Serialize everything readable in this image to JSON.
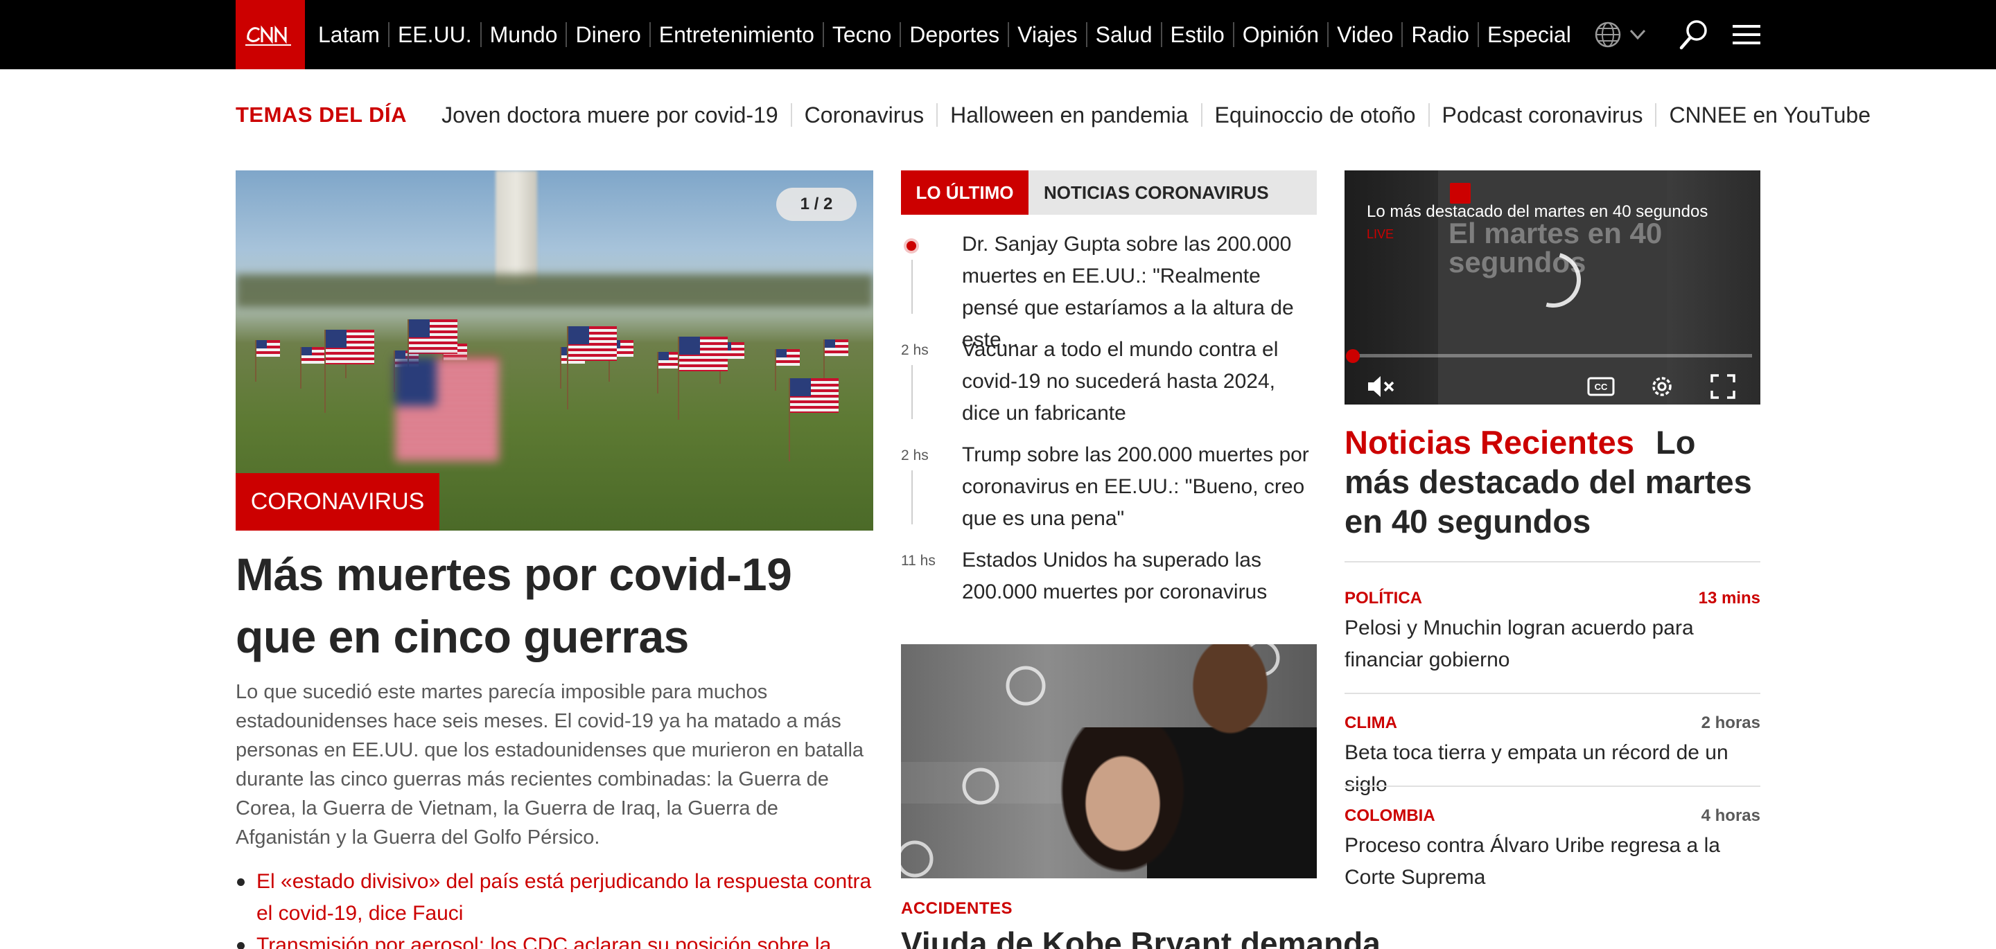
{
  "brand": {
    "logo_text": "CNN",
    "color": "#cc0000"
  },
  "nav": {
    "items": [
      "Latam",
      "EE.UU.",
      "Mundo",
      "Dinero",
      "Entretenimiento",
      "Tecno",
      "Deportes",
      "Viajes",
      "Salud",
      "Estilo",
      "Opinión",
      "Video",
      "Radio",
      "Especial"
    ],
    "icons": [
      "globe-icon",
      "chevron-down-icon",
      "search-icon",
      "menu-icon"
    ]
  },
  "trending": {
    "title": "TEMAS DEL DÍA",
    "items": [
      "Joven doctora muere por covid-19",
      "Coronavirus",
      "Halloween en pandemia",
      "Equinoccio de otoño",
      "Podcast coronavirus",
      "CNNEE en YouTube"
    ]
  },
  "hero": {
    "pager": "1 / 2",
    "label": "CORONAVIRUS",
    "title": "Más muertes por covid-19 que en cinco guerras",
    "summary": "Lo que sucedió este martes parecía imposible para muchos estadounidenses hace seis meses. El covid-19 ya ha matado a más personas en EE.UU. que los estadounidenses que murieron en batalla durante las cinco guerras más recientes combinadas: la Guerra de Corea, la Guerra de Vietnam, la Guerra de Iraq, la Guerra de Afganistán y la Guerra del Golfo Pérsico.",
    "links": [
      "El «estado divisivo» del país está perjudicando la respuesta contra el covid-19, dice Fauci",
      "Transmisión por aerosol: los CDC aclaran su posición sobre la"
    ]
  },
  "latest": {
    "tabs": [
      "LO ÚLTIMO",
      "NOTICIAS CORONAVIRUS"
    ],
    "items": [
      {
        "time": "",
        "live": true,
        "text": "Dr. Sanjay Gupta sobre las 200.000 muertes en EE.UU.: \"Realmente pensé que estaríamos a la altura de este..."
      },
      {
        "time": "2 hs",
        "live": false,
        "text": "Vacunar a todo el mundo contra el covid-19 no sucederá hasta 2024, dice un fabricante"
      },
      {
        "time": "2 hs",
        "live": false,
        "text": "Trump sobre las 200.000 muertes por coronavirus en EE.UU.: \"Bueno, creo que es una pena\""
      },
      {
        "time": "11 hs",
        "live": false,
        "text": "Estados Unidos ha superado las 200.000 muertes por coronavirus"
      }
    ]
  },
  "kobe": {
    "label": "ACCIDENTES",
    "title": "Viuda de Kobe Bryant demanda"
  },
  "video": {
    "title": "Lo más destacado del martes en 40 segundos",
    "live": "LIVE",
    "ghost_text": "El martes en 40 segundos",
    "controls": [
      "mute-icon",
      "cc-icon",
      "settings-icon",
      "fullscreen-icon"
    ],
    "progress": 0.0
  },
  "recent": {
    "label": "Noticias Recientes",
    "headline": "Lo más destacado del martes en 40 segundos",
    "items": [
      {
        "category": "POLÍTICA",
        "time": "13 mins",
        "time_color": "#cc0000",
        "headline": "Pelosi y Mnuchin logran acuerdo para financiar gobierno"
      },
      {
        "category": "CLIMA",
        "time": "2 horas",
        "time_color": "#595959",
        "headline": "Beta toca tierra y empata un récord de un siglo"
      },
      {
        "category": "COLOMBIA",
        "time": "4 horas",
        "time_color": "#595959",
        "headline": "Proceso contra Álvaro Uribe regresa a la Corte Suprema"
      }
    ]
  }
}
